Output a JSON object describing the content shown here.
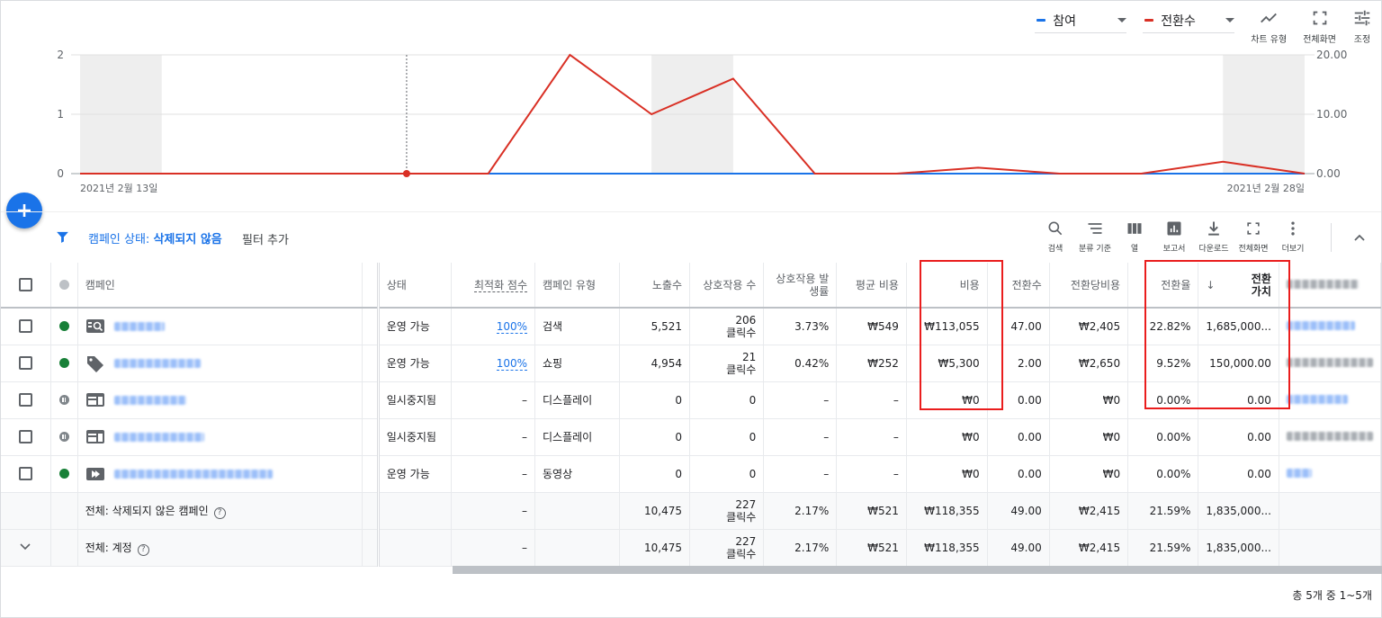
{
  "chart_controls": {
    "metric1": "참여",
    "metric1_color": "#1a73e8",
    "metric2": "전환수",
    "metric2_color": "#d93025",
    "chart_type_label": "차트 유형",
    "fullscreen_label": "전체화면",
    "adjust_label": "조정"
  },
  "chart_data": {
    "type": "line",
    "x_start_label": "2021년 2월 13일",
    "x_end_label": "2021년 2월 28일",
    "left_axis_ticks": [
      "0",
      "1",
      "2"
    ],
    "right_axis_ticks": [
      "0.00",
      "10.00",
      "20.00"
    ],
    "ylim_left": [
      0,
      2
    ],
    "ylim_right": [
      0,
      20
    ],
    "series": [
      {
        "name": "참여",
        "color": "#1a73e8",
        "values": [
          0,
          0,
          0,
          0,
          0,
          0,
          0,
          0,
          0,
          0,
          0,
          0,
          0,
          0,
          0,
          0
        ]
      },
      {
        "name": "전환수",
        "color": "#d93025",
        "values": [
          0,
          0,
          0,
          0,
          0,
          0,
          20,
          10,
          16,
          0,
          0,
          1,
          0,
          0,
          2,
          0
        ]
      }
    ],
    "weekend_bands": [
      [
        0,
        1
      ],
      [
        7,
        8
      ],
      [
        14,
        15
      ]
    ],
    "marker_index": 4
  },
  "filter": {
    "prefix": "캠페인 상태:",
    "value": "삭제되지 않음",
    "add_filter": "필터 추가"
  },
  "toolbar": [
    {
      "label": "검색",
      "icon": "search-icon"
    },
    {
      "label": "분류 기준",
      "icon": "segment-icon"
    },
    {
      "label": "열",
      "icon": "columns-icon"
    },
    {
      "label": "보고서",
      "icon": "report-icon"
    },
    {
      "label": "다운로드",
      "icon": "download-icon"
    },
    {
      "label": "전체화면",
      "icon": "fullscreen-icon"
    },
    {
      "label": "더보기",
      "icon": "more-icon"
    }
  ],
  "columns": {
    "campaign": "캠페인",
    "status": "상태",
    "opt_score": "최적화 점수",
    "type": "캠페인 유형",
    "impressions": "노출수",
    "interactions": "상호작용 수",
    "interaction_rate": "상호작용 발생률",
    "avg_cost": "평균 비용",
    "cost": "비용",
    "conversions": "전환수",
    "cost_per_conv": "전환당비용",
    "conv_rate": "전환율",
    "conv_value": "전환 가치"
  },
  "rows": [
    {
      "dot": "green",
      "icon": "search-campaign-icon",
      "status": "운영 가능",
      "opt": "100%",
      "type": "검색",
      "impr": "5,521",
      "inter": "206",
      "inter_unit": "클릭수",
      "irate": "3.73%",
      "avg": "₩549",
      "cost": "₩113,055",
      "conv": "47.00",
      "cpc": "₩2,405",
      "crate": "22.82%",
      "cval": "1,685,000..."
    },
    {
      "dot": "green",
      "icon": "shopping-campaign-icon",
      "status": "운영 가능",
      "opt": "100%",
      "type": "쇼핑",
      "impr": "4,954",
      "inter": "21",
      "inter_unit": "클릭수",
      "irate": "0.42%",
      "avg": "₩252",
      "cost": "₩5,300",
      "conv": "2.00",
      "cpc": "₩2,650",
      "crate": "9.52%",
      "cval": "150,000.00"
    },
    {
      "dot": "pause",
      "icon": "display-campaign-icon",
      "status": "일시중지됨",
      "opt": "–",
      "type": "디스플레이",
      "impr": "0",
      "inter": "0",
      "inter_unit": "",
      "irate": "–",
      "avg": "–",
      "cost": "₩0",
      "conv": "0.00",
      "cpc": "₩0",
      "crate": "0.00%",
      "cval": "0.00"
    },
    {
      "dot": "pause",
      "icon": "display-campaign-icon",
      "status": "일시중지됨",
      "opt": "–",
      "type": "디스플레이",
      "impr": "0",
      "inter": "0",
      "inter_unit": "",
      "irate": "–",
      "avg": "–",
      "cost": "₩0",
      "conv": "0.00",
      "cpc": "₩0",
      "crate": "0.00%",
      "cval": "0.00"
    },
    {
      "dot": "green",
      "icon": "video-campaign-icon",
      "status": "운영 가능",
      "opt": "–",
      "type": "동영상",
      "impr": "0",
      "inter": "0",
      "inter_unit": "",
      "irate": "–",
      "avg": "–",
      "cost": "₩0",
      "conv": "0.00",
      "cpc": "₩0",
      "crate": "0.00%",
      "cval": "0.00"
    }
  ],
  "totals": [
    {
      "label": "전체: 삭제되지 않은 캠페인",
      "opt": "–",
      "impr": "10,475",
      "inter": "227",
      "inter_unit": "클릭수",
      "irate": "2.17%",
      "avg": "₩521",
      "cost": "₩118,355",
      "conv": "49.00",
      "cpc": "₩2,415",
      "crate": "21.59%",
      "cval": "1,835,000..."
    },
    {
      "label": "전체: 계정",
      "opt": "–",
      "impr": "10,475",
      "inter": "227",
      "inter_unit": "클릭수",
      "irate": "2.17%",
      "avg": "₩521",
      "cost": "₩118,355",
      "conv": "49.00",
      "cpc": "₩2,415",
      "crate": "21.59%",
      "cval": "1,835,000..."
    }
  ],
  "pagination": "총 5개 중 1~5개"
}
